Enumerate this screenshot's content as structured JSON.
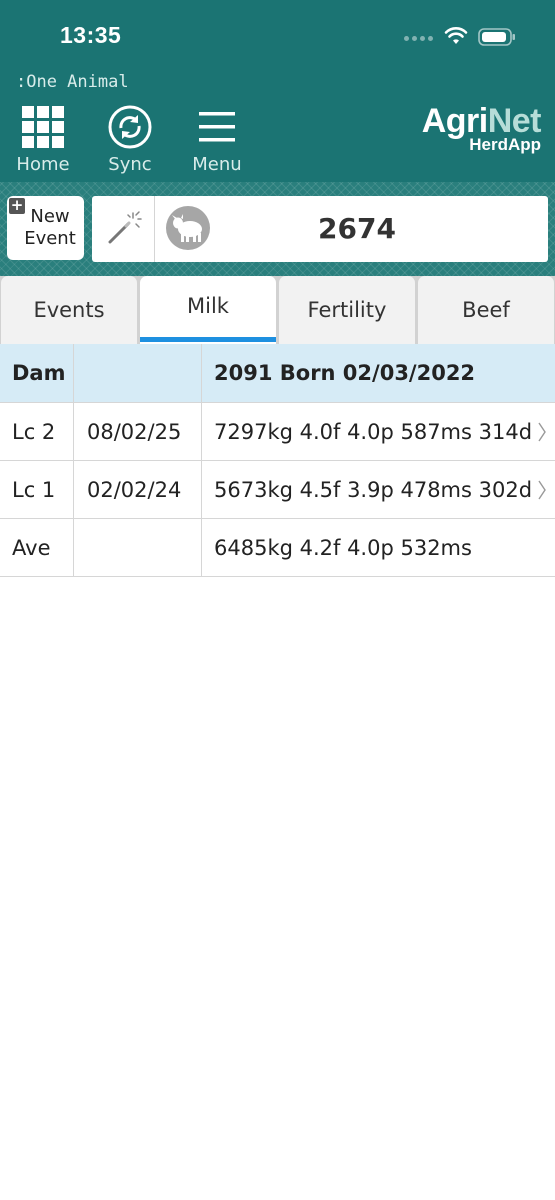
{
  "status_bar": {
    "time": "13:35"
  },
  "screen_title": ":One Animal",
  "nav": {
    "home_label": "Home",
    "sync_label": "Sync",
    "menu_label": "Menu"
  },
  "logo": {
    "part1": "Agri",
    "part2": "Net",
    "sub": "HerdApp"
  },
  "new_event": {
    "line1": "New",
    "line2": "Event"
  },
  "animal": {
    "number": "2674"
  },
  "tabs": [
    {
      "label": "Events",
      "active": false
    },
    {
      "label": "Milk",
      "active": true
    },
    {
      "label": "Fertility",
      "active": false
    },
    {
      "label": "Beef",
      "active": false
    }
  ],
  "table": {
    "header": {
      "col1": "Dam",
      "col2": "",
      "col3": "2091 Born 02/03/2022"
    },
    "rows": [
      {
        "col1": "Lc 2",
        "col2": "08/02/25",
        "col3": "7297kg 4.0f 4.0p 587ms 314d",
        "has_chevron": true
      },
      {
        "col1": "Lc 1",
        "col2": "02/02/24",
        "col3": "5673kg 4.5f 3.9p 478ms 302d",
        "has_chevron": true
      },
      {
        "col1": "Ave",
        "col2": "",
        "col3": "6485kg 4.2f 4.0p 532ms",
        "has_chevron": false
      }
    ]
  },
  "colors": {
    "header_bg": "#1b7473",
    "tab_active_underline": "#1e90e0",
    "table_header_bg": "#d6ebf6"
  },
  "icons": {
    "home": "grid-icon",
    "sync": "sync-icon",
    "menu": "hamburger-icon",
    "wand": "magic-wand-icon",
    "animal": "cow-icon"
  }
}
